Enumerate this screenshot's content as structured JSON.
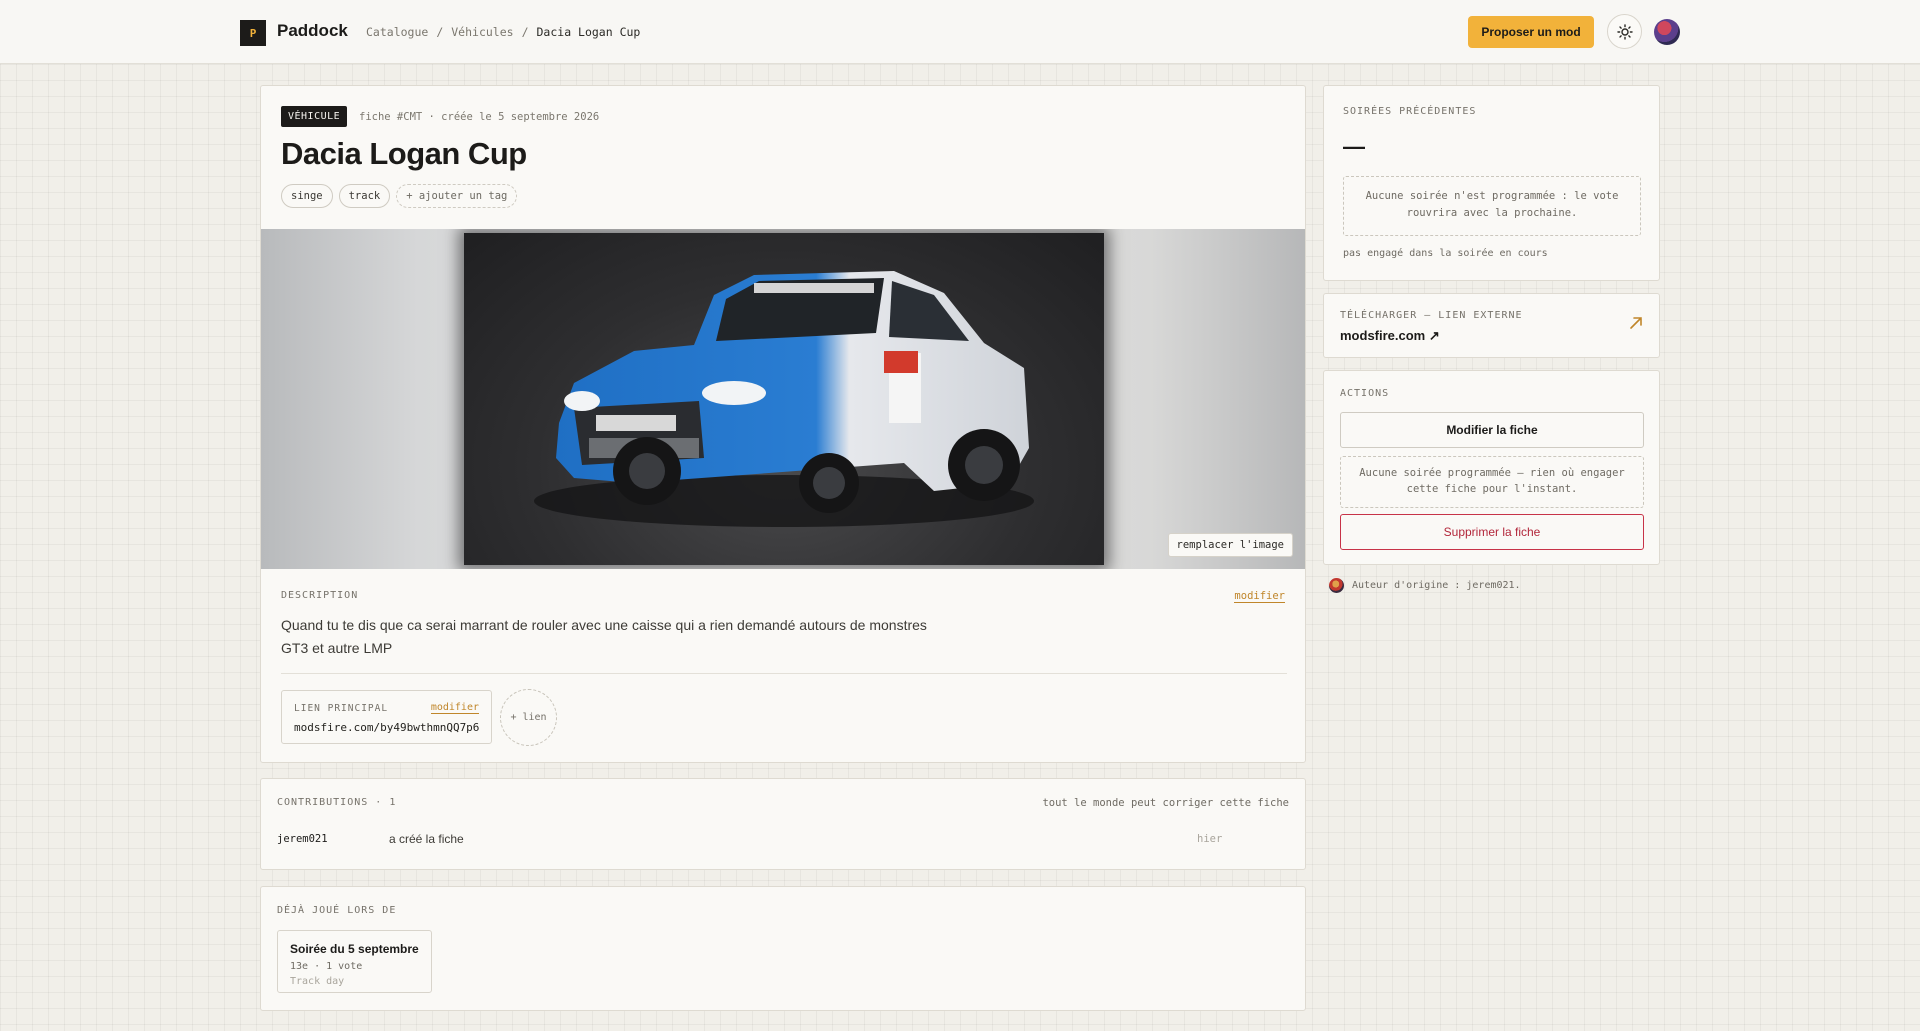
{
  "header": {
    "logo_letter": "P",
    "brand": "Paddock",
    "breadcrumb": [
      "Catalogue",
      "Véhicules",
      "Dacia Logan Cup"
    ],
    "breadcrumb_sep": "/",
    "propose_label": "Proposer un mod",
    "theme_icon": "sun-icon"
  },
  "item": {
    "badge": "VÉHICULE",
    "meta": "fiche #CMT · créée le 5 septembre 2026",
    "title": "Dacia Logan Cup",
    "tags": [
      "singe",
      "track"
    ],
    "add_tag_label": "+ ajouter un tag",
    "replace_image_label": "remplacer l'image",
    "description_label": "DESCRIPTION",
    "description_edit": "modifier",
    "description": "Quand tu te dis que ca serai marrant de rouler avec une caisse qui a rien demandé autours de monstres GT3 et autre LMP",
    "main_link_label": "LIEN PRINCIPAL",
    "main_link_edit": "modifier",
    "main_link_url": "modsfire.com/by49bwthmnQQ7p6",
    "add_link_label": "+ lien"
  },
  "contributions": {
    "label": "CONTRIBUTIONS · 1",
    "note": "tout le monde peut corriger cette fiche",
    "rows": [
      {
        "user": "jerem021",
        "action": "a créé la fiche",
        "when": "hier"
      }
    ]
  },
  "played": {
    "label": "DÉJÀ JOUÉ LORS DE",
    "sessions": [
      {
        "name": "Soirée du 5 septembre",
        "stats": "13e · 1 vote",
        "type": "Track day"
      }
    ]
  },
  "sidebar": {
    "previous": {
      "label": "SOIRÉES PRÉCÉDENTES",
      "value": "—",
      "empty": "Aucune soirée n'est programmée : le vote rouvrira avec la prochaine.",
      "status": "pas engagé dans la soirée en cours"
    },
    "download": {
      "label": "TÉLÉCHARGER — LIEN EXTERNE",
      "host": "modsfire.com ↗"
    },
    "actions": {
      "label": "ACTIONS",
      "edit": "Modifier la fiche",
      "empty": "Aucune soirée programmée — rien où engager cette fiche pour l'instant.",
      "delete": "Supprimer la fiche"
    },
    "author": "Auteur d'origine : jerem021."
  },
  "colors": {
    "accent": "#f2b23a",
    "danger": "#b2263a",
    "link": "#c0862a",
    "car_blue": "#1f6fc4"
  }
}
